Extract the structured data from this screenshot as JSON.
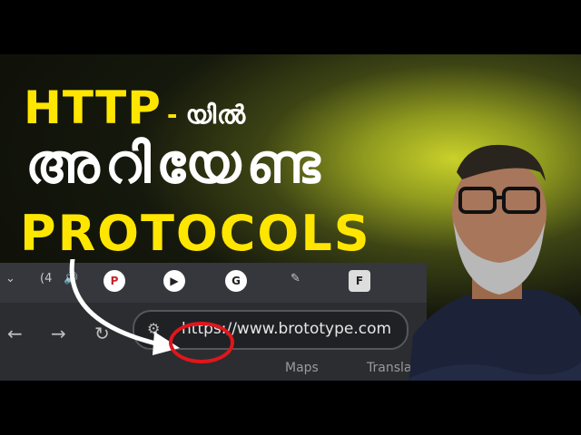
{
  "headline": {
    "line1_en": "HTTP",
    "line1_dash": "-",
    "line1_ml": "യിൽ",
    "line2_ml": "അറിയേണ്ട",
    "line3_en": "PROTOCOLS"
  },
  "browser": {
    "url": "https://www.brototype.com",
    "tab_count": "(4",
    "bookmark_maps": "Maps",
    "bookmark_translate": "Translate"
  },
  "colors": {
    "accent_yellow": "#ffe600",
    "circle_red": "#e0161b"
  }
}
